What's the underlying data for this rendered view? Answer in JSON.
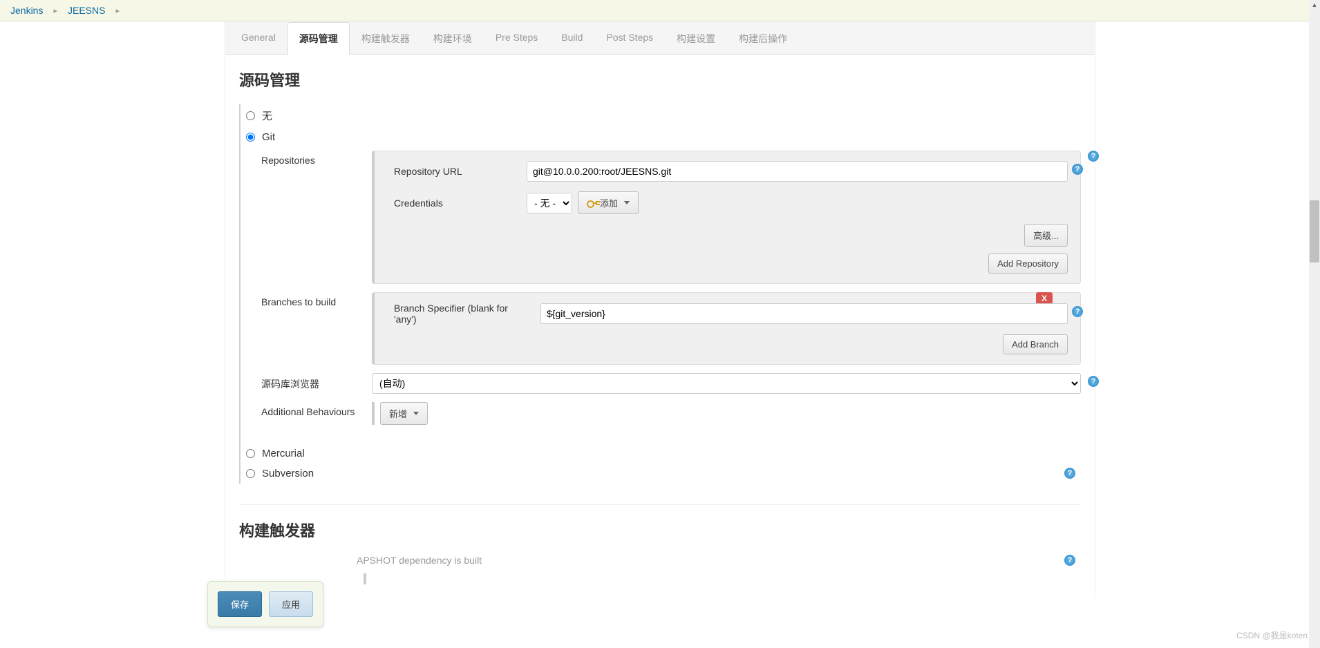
{
  "breadcrumb": {
    "items": [
      "Jenkins",
      "JEESNS"
    ]
  },
  "tabs": {
    "items": [
      "General",
      "源码管理",
      "构建触发器",
      "构建环境",
      "Pre Steps",
      "Build",
      "Post Steps",
      "构建设置",
      "构建后操作"
    ],
    "active_index": 1
  },
  "section": {
    "title": "源码管理"
  },
  "scm_options": {
    "none": "无",
    "git": "Git",
    "mercurial": "Mercurial",
    "subversion": "Subversion",
    "selected": "git"
  },
  "git": {
    "repositories_label": "Repositories",
    "repo_url_label": "Repository URL",
    "repo_url_value": "git@10.0.0.200:root/JEESNS.git",
    "credentials_label": "Credentials",
    "credentials_value": "- 无 -",
    "add_label": "添加",
    "advanced_label": "高级...",
    "add_repo_label": "Add Repository",
    "branches_label": "Branches to build",
    "branch_spec_label": "Branch Specifier (blank for 'any')",
    "branch_spec_value": "${git_version}",
    "add_branch_label": "Add Branch",
    "delete_label": "X",
    "browser_label": "源码库浏览器",
    "browser_value": "(自动)",
    "behaviours_label": "Additional Behaviours",
    "behaviours_add": "新增"
  },
  "next_section": {
    "title": "构建触发器",
    "snapshot_text": "APSHOT dependency is built"
  },
  "footer": {
    "save": "保存",
    "apply": "应用"
  },
  "watermark": "CSDN @我是koten"
}
